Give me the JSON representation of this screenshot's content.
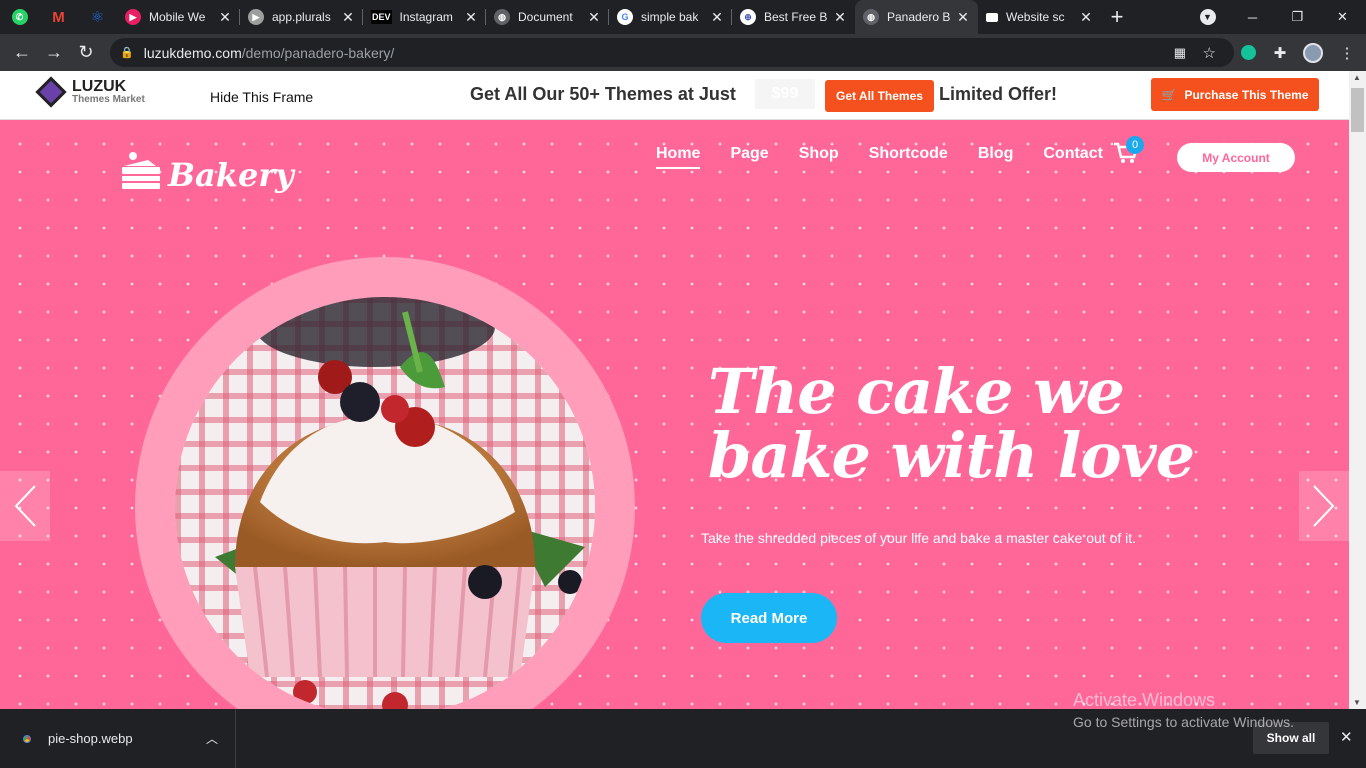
{
  "browser": {
    "pinned": [
      {
        "icon": "whatsapp-icon",
        "color": "#25d366"
      },
      {
        "icon": "gmail-icon",
        "color": "#ea4335"
      },
      {
        "icon": "atom-icon",
        "color": "#1a73e8"
      }
    ],
    "tabs": [
      {
        "title": "Mobile We",
        "icon": "media-icon",
        "color": "#e91e63"
      },
      {
        "title": "app.plurals",
        "icon": "pluralsight-icon",
        "color": "#9e9e9e"
      },
      {
        "title": "Instagram",
        "icon": "dev-icon",
        "color": "#000000",
        "text": "DEV"
      },
      {
        "title": "Document",
        "icon": "globe-icon",
        "color": "#9aa0a6"
      },
      {
        "title": "simple bak",
        "icon": "google-icon",
        "color": "#4285f4"
      },
      {
        "title": "Best Free B",
        "icon": "web-icon",
        "color": "#3f51b5"
      },
      {
        "title": "Panadero B",
        "icon": "globe-icon",
        "color": "#9aa0a6",
        "active": true
      },
      {
        "title": "Website sc",
        "icon": "video-icon",
        "color": "#ffffff"
      }
    ],
    "new_tab": "+",
    "url_host": "luzukdemo.com",
    "url_path": "/demo/panadero-bakery/"
  },
  "frame": {
    "brand": "LUZUK",
    "brand_sub": "Themes Market",
    "hide_frame": "Hide This Frame",
    "promo": "Get All Our 50+ Themes at Just",
    "price": "$99",
    "get_all": "Get All Themes",
    "limited": "Limited Offer!",
    "purchase": "Purchase This Theme"
  },
  "site": {
    "logo": "Bakery",
    "nav": [
      "Home",
      "Page",
      "Shop",
      "Shortcode",
      "Blog",
      "Contact"
    ],
    "nav_active": 0,
    "cart_count": "0",
    "account": "My Account",
    "headline_1": "The cake we",
    "headline_2": "bake with love",
    "paragraph": "Take the shredded pieces of your life and bake a master cake out of it.",
    "cta": "Read More",
    "pink": "#ff6799",
    "cta_color": "#1ab6f5"
  },
  "os": {
    "watermark_title": "Activate Windows",
    "watermark_sub": "Go to Settings to activate Windows."
  },
  "downloads": {
    "file": "pie-shop.webp",
    "show_all": "Show all"
  }
}
